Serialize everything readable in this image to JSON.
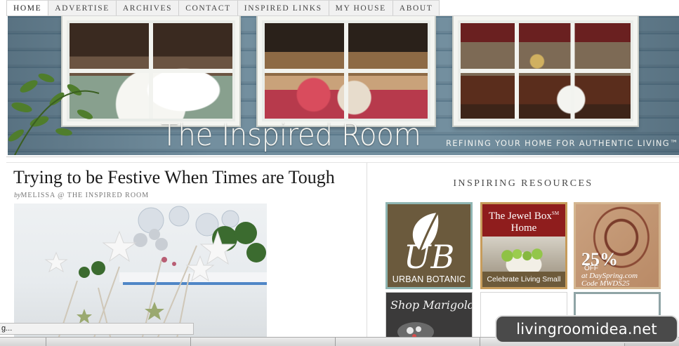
{
  "nav": {
    "items": [
      {
        "label": "HOME",
        "active": true
      },
      {
        "label": "ADVERTISE",
        "active": false
      },
      {
        "label": "ARCHIVES",
        "active": false
      },
      {
        "label": "CONTACT",
        "active": false
      },
      {
        "label": "INSPIRED LINKS",
        "active": false
      },
      {
        "label": "MY HOUSE",
        "active": false
      },
      {
        "label": "ABOUT",
        "active": false
      }
    ]
  },
  "header": {
    "logo": "The Inspired Room",
    "tagline": "REFINING YOUR HOME FOR AUTHENTIC LIVING™"
  },
  "post": {
    "title": "Trying to be Festive When Times are Tough",
    "byline_prefix": "by",
    "author": "MELISSA @ THE INSPIRED ROOM"
  },
  "sidebar": {
    "title": "INSPIRING RESOURCES",
    "ads": {
      "urban_botanic": {
        "mark": "UB",
        "name": "URBAN BOTANIC",
        "color": "#6b5a3d",
        "border": "#8fb5b2"
      },
      "jewel_box": {
        "title_line1": "The Jewel Box",
        "sm": "SM",
        "title_line2": "Home",
        "footer": "Celebrate Living Small",
        "color": "#8f1d1d"
      },
      "dayspring": {
        "percent": "25%",
        "off": "OFF",
        "line1": "at DaySpring.com",
        "line2": "Code MWDS25"
      },
      "marigold": {
        "text": "Shop Marigold"
      }
    }
  },
  "browser": {
    "status_text": "g...",
    "tab_count": 5
  },
  "watermark": "livingroomidea.net",
  "colors": {
    "siding": "#738f9f",
    "accent_red": "#8f1d1d",
    "nav_bg": "#f1f1f1"
  }
}
